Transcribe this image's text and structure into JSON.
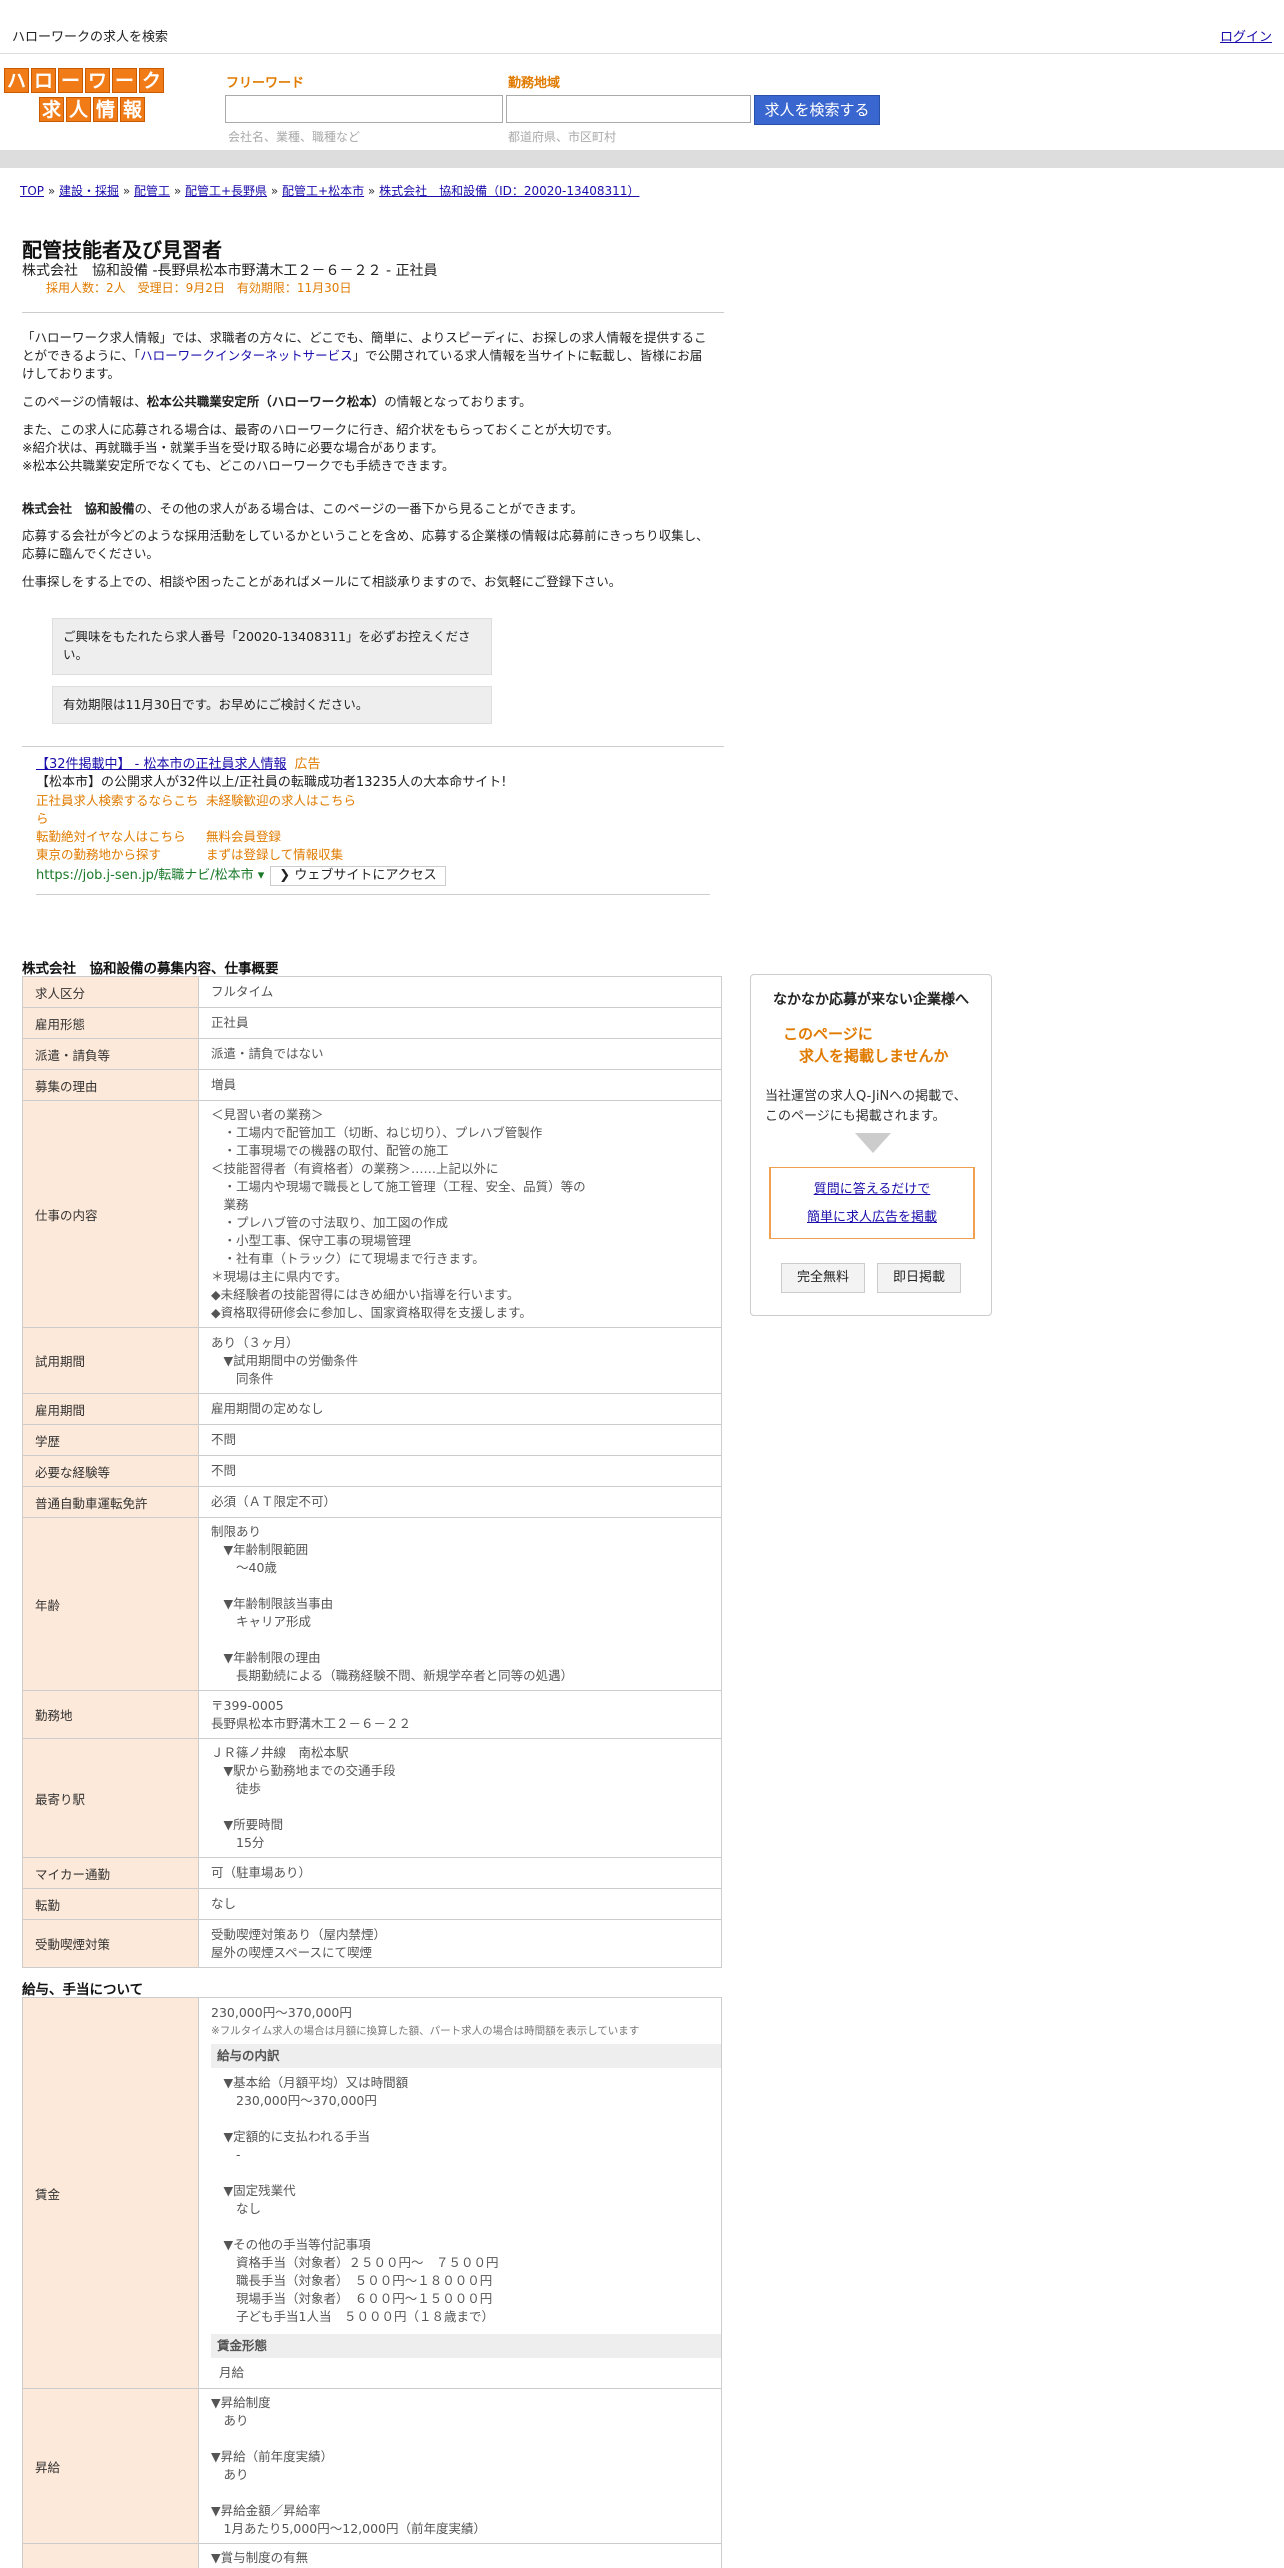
{
  "header": {
    "site_title": "ハローワークの求人を検索",
    "login": "ログイン"
  },
  "logo": {
    "row1": [
      "ハ",
      "ロ",
      "ー",
      "ワ",
      "ー",
      "ク"
    ],
    "row2": [
      "求",
      "人",
      "情",
      "報"
    ]
  },
  "search": {
    "keyword_label": "フリーワード",
    "keyword_hint": "会社名、業種、職種など",
    "area_label": "勤務地域",
    "area_hint": "都道府県、市区町村",
    "button": "求人を検索する"
  },
  "breadcrumb": {
    "items": [
      "TOP",
      "建設・採掘",
      "配管工",
      "配管工+長野県",
      "配管工+松本市",
      "株式会社　協和設備（ID：20020-13408311）"
    ],
    "sep": " » "
  },
  "job": {
    "title": "配管技能者及び見習者",
    "subtitle": "株式会社　協和設備 -長野県松本市野溝木工２－６－２２ - 正社員",
    "meta": "採用人数：2人　受理日：9月2日　有効期限：11月30日"
  },
  "intro": {
    "p1a": "「ハローワーク求人情報」では、求職者の方々に、どこでも、簡単に、よりスピーディに、お探しの求人情報を提供することができるように、「",
    "p1link": "ハローワークインターネットサービス",
    "p1b": "」で公開されている求人情報を当サイトに転載し、皆様にお届けしております。",
    "p2a": "このページの情報は、",
    "p2b": "松本公共職業安定所（ハローワーク松本）",
    "p2c": "の情報となっております。",
    "p3": "また、この求人に応募される場合は、最寄のハローワークに行き、紹介状をもらっておくことが大切です。",
    "p4": "※紹介状は、再就職手当・就業手当を受け取る時に必要な場合があります。",
    "p5": "※松本公共職業安定所でなくても、どこのハローワークでも手続きできます。",
    "p6a": "株式会社　協和設備",
    "p6b": "の、その他の求人がある場合は、このページの一番下から見ることができます。",
    "p7": "応募する会社が今どのような採用活動をしているかということを含め、応募する企業様の情報は応募前にきっちり収集し、応募に臨んでください。",
    "p8": "仕事探しをする上での、相談や困ったことがあればメールにて相談承りますので、お気軽にご登録下さい。"
  },
  "notices": [
    "ご興味をもたれたら求人番号「20020-13408311」を必ずお控えください。",
    "有効期限は11月30日です。お早めにご検討ください。"
  ],
  "ad": {
    "title": "【32件掲載中】 - 松本市の正社員求人情報",
    "tag": "広告",
    "desc": "【松本市】の公開求人が32件以上/正社員の転職成功者13235人の大本命サイト!",
    "links": [
      "正社員求人検索するならこちら",
      "未経験歓迎の求人はこちら",
      "転勤絶対イヤな人はこちら",
      "無料会員登録",
      "東京の勤務地から探す",
      "まずは登録して情報収集"
    ],
    "url": "https://job.j-sen.jp/転職ナビ/松本市",
    "url_caret": "▾",
    "visit": "❯ ウェブサイトにアクセス"
  },
  "section1_title": "株式会社　協和設備の募集内容、仕事概要",
  "rows": [
    {
      "k": "求人区分",
      "v": "フルタイム"
    },
    {
      "k": "雇用形態",
      "v": "正社員"
    },
    {
      "k": "派遣・請負等",
      "v": "派遣・請負ではない"
    },
    {
      "k": "募集の理由",
      "v": "増員"
    },
    {
      "k": "仕事の内容",
      "v": "＜見習い者の業務＞\n　・工場内で配管加工（切断、ねじ切り）、プレハブ管製作\n　・工事現場での機器の取付、配管の施工\n＜技能習得者（有資格者）の業務＞……上記以外に\n　・工場内や現場で職長として施工管理（工程、安全、品質）等の\n　業務\n　・プレハブ管の寸法取り、加工図の作成\n　・小型工事、保守工事の現場管理\n　・社有車（トラック）にて現場まで行きます。\n＊現場は主に県内です。\n◆未経験者の技能習得にはきめ細かい指導を行います。\n◆資格取得研修会に参加し、国家資格取得を支援します。"
    },
    {
      "k": "試用期間",
      "v": "あり（３ヶ月）\n　▼試用期間中の労働条件\n　　同条件"
    },
    {
      "k": "雇用期間",
      "v": "雇用期間の定めなし"
    },
    {
      "k": "学歴",
      "v": "不問"
    },
    {
      "k": "必要な経験等",
      "v": "不問"
    },
    {
      "k": "普通自動車運転免許",
      "v": "必須（ＡＴ限定不可）"
    },
    {
      "k": "年齢",
      "v": "制限あり\n　▼年齢制限範囲\n　　〜40歳\n\n　▼年齢制限該当事由\n　　キャリア形成\n\n　▼年齢制限の理由\n　　長期勤続による（職務経験不問、新規学卒者と同等の処遇）"
    },
    {
      "k": "勤務地",
      "v": "〒399-0005\n長野県松本市野溝木工２－６－２２"
    },
    {
      "k": "最寄り駅",
      "v": "ＪＲ篠ノ井線　南松本駅\n　▼駅から勤務地までの交通手段\n　　徒歩\n\n　▼所要時間\n　　15分"
    },
    {
      "k": "マイカー通勤",
      "v": "可（駐車場あり）"
    },
    {
      "k": "転勤",
      "v": "なし"
    },
    {
      "k": "受動喫煙対策",
      "v": "受動喫煙対策あり（屋内禁煙）\n屋外の喫煙スペースにて喫煙"
    }
  ],
  "section2_title": "給与、手当について",
  "salary": {
    "k": "賃金",
    "range": "230,000円〜370,000円",
    "note": "※フルタイム求人の場合は月額に換算した額、パート求人の場合は時間額を表示しています",
    "breakdown_title": "給与の内訳",
    "breakdown": "　▼基本給（月額平均）又は時間額\n　　230,000円〜370,000円\n\n　▼定額的に支払われる手当\n　　-\n\n　▼固定残業代\n　　なし\n\n　▼その他の手当等付記事項\n　　資格手当（対象者）２５００円～　７５００円\n　　職長手当（対象者）　５００円～１８０００円\n　　現場手当（対象者）　６００円～１５０００円\n　　子ども手当1人当　５０００円（１８歳まで）",
    "form_title": "賃金形態",
    "form": "月給"
  },
  "raise": {
    "k": "昇給",
    "v": "▼昇給制度\n　あり\n\n▼昇給（前年度実績）\n　あり\n\n▼昇給金額／昇給率\n　1月あたり5,000円〜12,000円（前年度実績）"
  },
  "bonus": {
    "v": "▼賞与制度の有無\n　あり"
  },
  "sidebox": {
    "heading": "なかなか応募が来ない企業様へ",
    "offer1": "このページに",
    "offer2": "求人を掲載しませんか",
    "desc1": "当社運営の求人Q-JiNへの掲載で、",
    "desc2": "このページにも掲載されます。",
    "cta1": "質問に答えるだけで",
    "cta2": "簡単に求人広告を掲載",
    "btn_free": "完全無料",
    "btn_today": "即日掲載"
  },
  "colors": {
    "accent_orange": "#f07b17",
    "label_orange": "#e07b00",
    "key_bg": "#fde9d9",
    "button_blue": "#3a66cf",
    "link": "#1a0dab"
  }
}
